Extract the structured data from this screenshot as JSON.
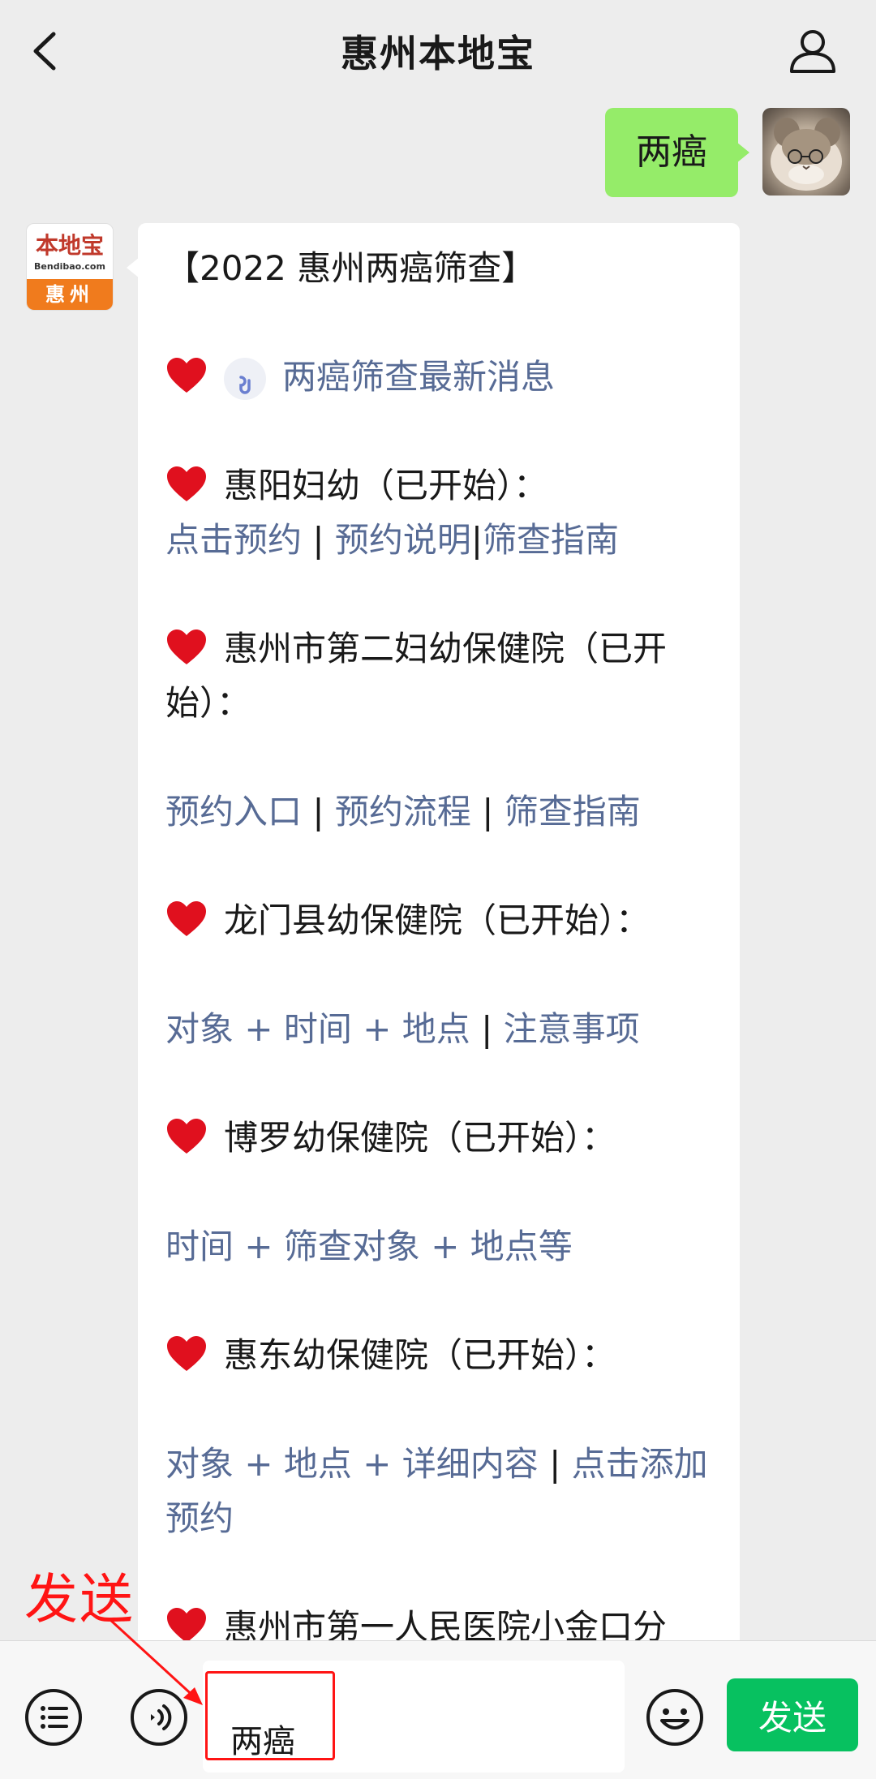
{
  "header": {
    "title": "惠州本地宝"
  },
  "user_message": {
    "text": "两癌"
  },
  "bot_avatar": {
    "logo_cn": "本地宝",
    "logo_en": "Bendibao.com",
    "logo_city": "惠州"
  },
  "bot_message": {
    "title": "【2022 惠州两癌筛查】",
    "news_link": "两癌筛查最新消息",
    "sections": [
      {
        "heading": "惠阳妇幼（已开始）：",
        "links": [
          "点击预约",
          "预约说明",
          "筛查指南"
        ]
      },
      {
        "heading_line1": "惠州市第二妇幼保健院（已开",
        "heading_line2": "始）：",
        "links": [
          "预约入口",
          "预约流程",
          "筛查指南"
        ]
      },
      {
        "heading": "龙门县幼保健院（已开始）：",
        "links": [
          "对象 + 时间 + 地点",
          "注意事项"
        ]
      },
      {
        "heading": "博罗幼保健院（已开始）：",
        "links": [
          "时间 + 筛查对象 + 地点等"
        ]
      },
      {
        "heading": "惠东幼保健院（已开始）：",
        "links": [
          "对象 + 地点 + 详细内容",
          "点击添加"
        ],
        "links_line2": "预约"
      },
      {
        "heading": "惠州市第一人民医院小金口分"
      }
    ]
  },
  "toolbar": {
    "input_value": "两癌",
    "send_label": "发送"
  },
  "annotation": {
    "label": "发送",
    "color": "#ff1414"
  },
  "icons": {
    "back": "back-icon",
    "profile": "profile-icon",
    "news": "mini-program-icon",
    "heart": "heart-icon",
    "menu": "menu-icon",
    "voice": "voice-icon",
    "emoji": "emoji-icon"
  },
  "colors": {
    "background": "#ededed",
    "user_bubble": "#95ec69",
    "link": "#576b95",
    "send_button": "#07c160",
    "heart": "#e0101e"
  }
}
